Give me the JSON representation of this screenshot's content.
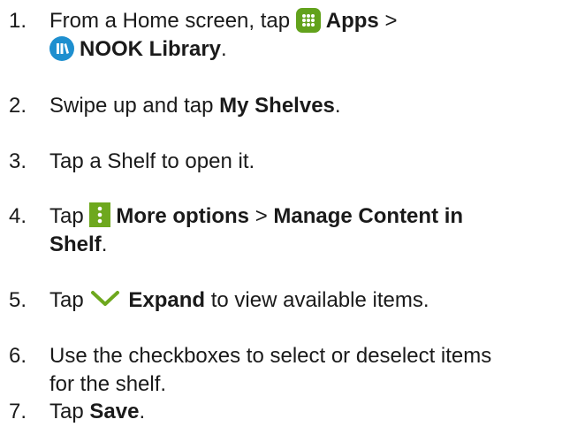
{
  "steps": [
    {
      "number": "1.",
      "prefix": "From a Home screen, tap",
      "apps_icon": "apps-grid-icon",
      "apps_label": "Apps",
      "sep": ">",
      "nook_icon": "nook-library-icon",
      "nook_label": "NOOK Library",
      "end": "."
    },
    {
      "number": "2.",
      "prefix": "Swipe up and tap",
      "bold": "My Shelves",
      "end": "."
    },
    {
      "number": "3.",
      "text": "Tap a Shelf to open it."
    },
    {
      "number": "4.",
      "prefix": "Tap",
      "icon": "more-options-icon",
      "bold1": "More options",
      "sep": ">",
      "bold2": "Manage Content in",
      "bold2_line2": "Shelf",
      "end": "."
    },
    {
      "number": "5.",
      "prefix": "Tap",
      "icon": "expand-chevron-icon",
      "bold": "Expand",
      "suffix": "to view available items."
    },
    {
      "number": "6.",
      "line1": "Use the checkboxes to select or deselect items",
      "line2": "for the shelf."
    },
    {
      "number": "7.",
      "prefix": "Tap",
      "bold": "Save",
      "end": "."
    }
  ],
  "colors": {
    "text": "#1a1a1a",
    "apps_icon_bg": "#62a21c",
    "nook_icon_bg": "#1e8fcf",
    "more_icon_bg": "#6ea81e",
    "expand_icon": "#6ea81e"
  }
}
